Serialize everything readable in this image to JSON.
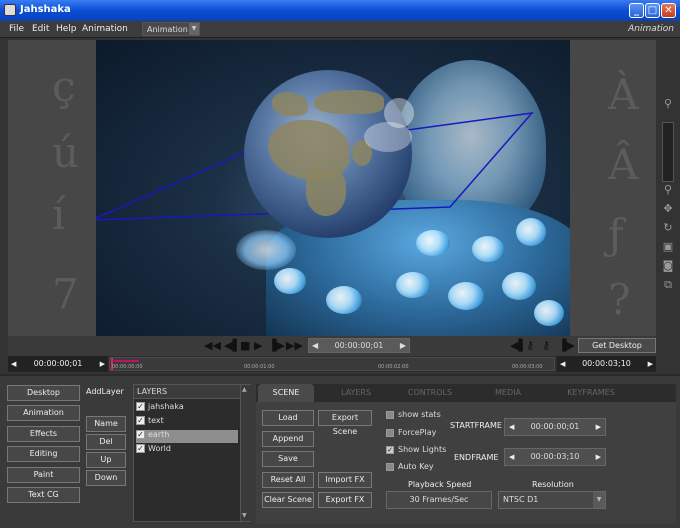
{
  "window": {
    "title": "Jahshaka",
    "min": "_",
    "max": "□",
    "close": "✕"
  },
  "menu": {
    "file": "File",
    "edit": "Edit",
    "help": "Help",
    "animation": "Animation"
  },
  "mode_select": {
    "value": "Animation",
    "label_right": "Animation"
  },
  "transport": {
    "current_time": "00:00:00;01",
    "get_desktop": "Get Desktop"
  },
  "timeline": {
    "start_time": "00:00:00;01",
    "end_time": "00:00:03;10",
    "ruler_labels": [
      "00:00:00:00",
      "00:00:01:00",
      "00:00:02:00",
      "00:00:03:00"
    ]
  },
  "modules": [
    "Desktop",
    "Animation",
    "Effects",
    "Editing",
    "Paint",
    "Text CG"
  ],
  "layer_buttons": {
    "add": "AddLayer",
    "name": "Name",
    "del": "Del",
    "up": "Up",
    "down": "Down"
  },
  "layers": {
    "header": "LAYERS",
    "items": [
      "jahshaka",
      "text",
      "earth",
      "World"
    ],
    "selected": "earth"
  },
  "tabs": [
    "SCENE",
    "LAYERS",
    "CONTROLS",
    "MEDIA",
    "KEYFRAMES"
  ],
  "scene": {
    "load": "Load",
    "export_scene": "Export Scene",
    "append": "Append",
    "save": "Save",
    "reset_all": "Reset All",
    "import_fx": "Import FX",
    "clear_scene": "Clear Scene",
    "export_fx": "Export FX",
    "show_stats": "show stats",
    "forceplay": "ForcePlay",
    "show_lights": "Show Lights",
    "auto_key": "Auto Key",
    "startframe_label": "STARTFRAME",
    "startframe_value": "00:00:00;01",
    "endframe_label": "ENDFRAME",
    "endframe_value": "00:00:03;10",
    "playback_label": "Playback Speed",
    "playback_value": "30 Frames/Sec",
    "resolution_label": "Resolution",
    "resolution_value": "NTSC D1"
  },
  "bg_glyphs": [
    "ç",
    "ú",
    "í",
    "7",
    "À",
    "Â",
    "ƒ",
    "?"
  ]
}
